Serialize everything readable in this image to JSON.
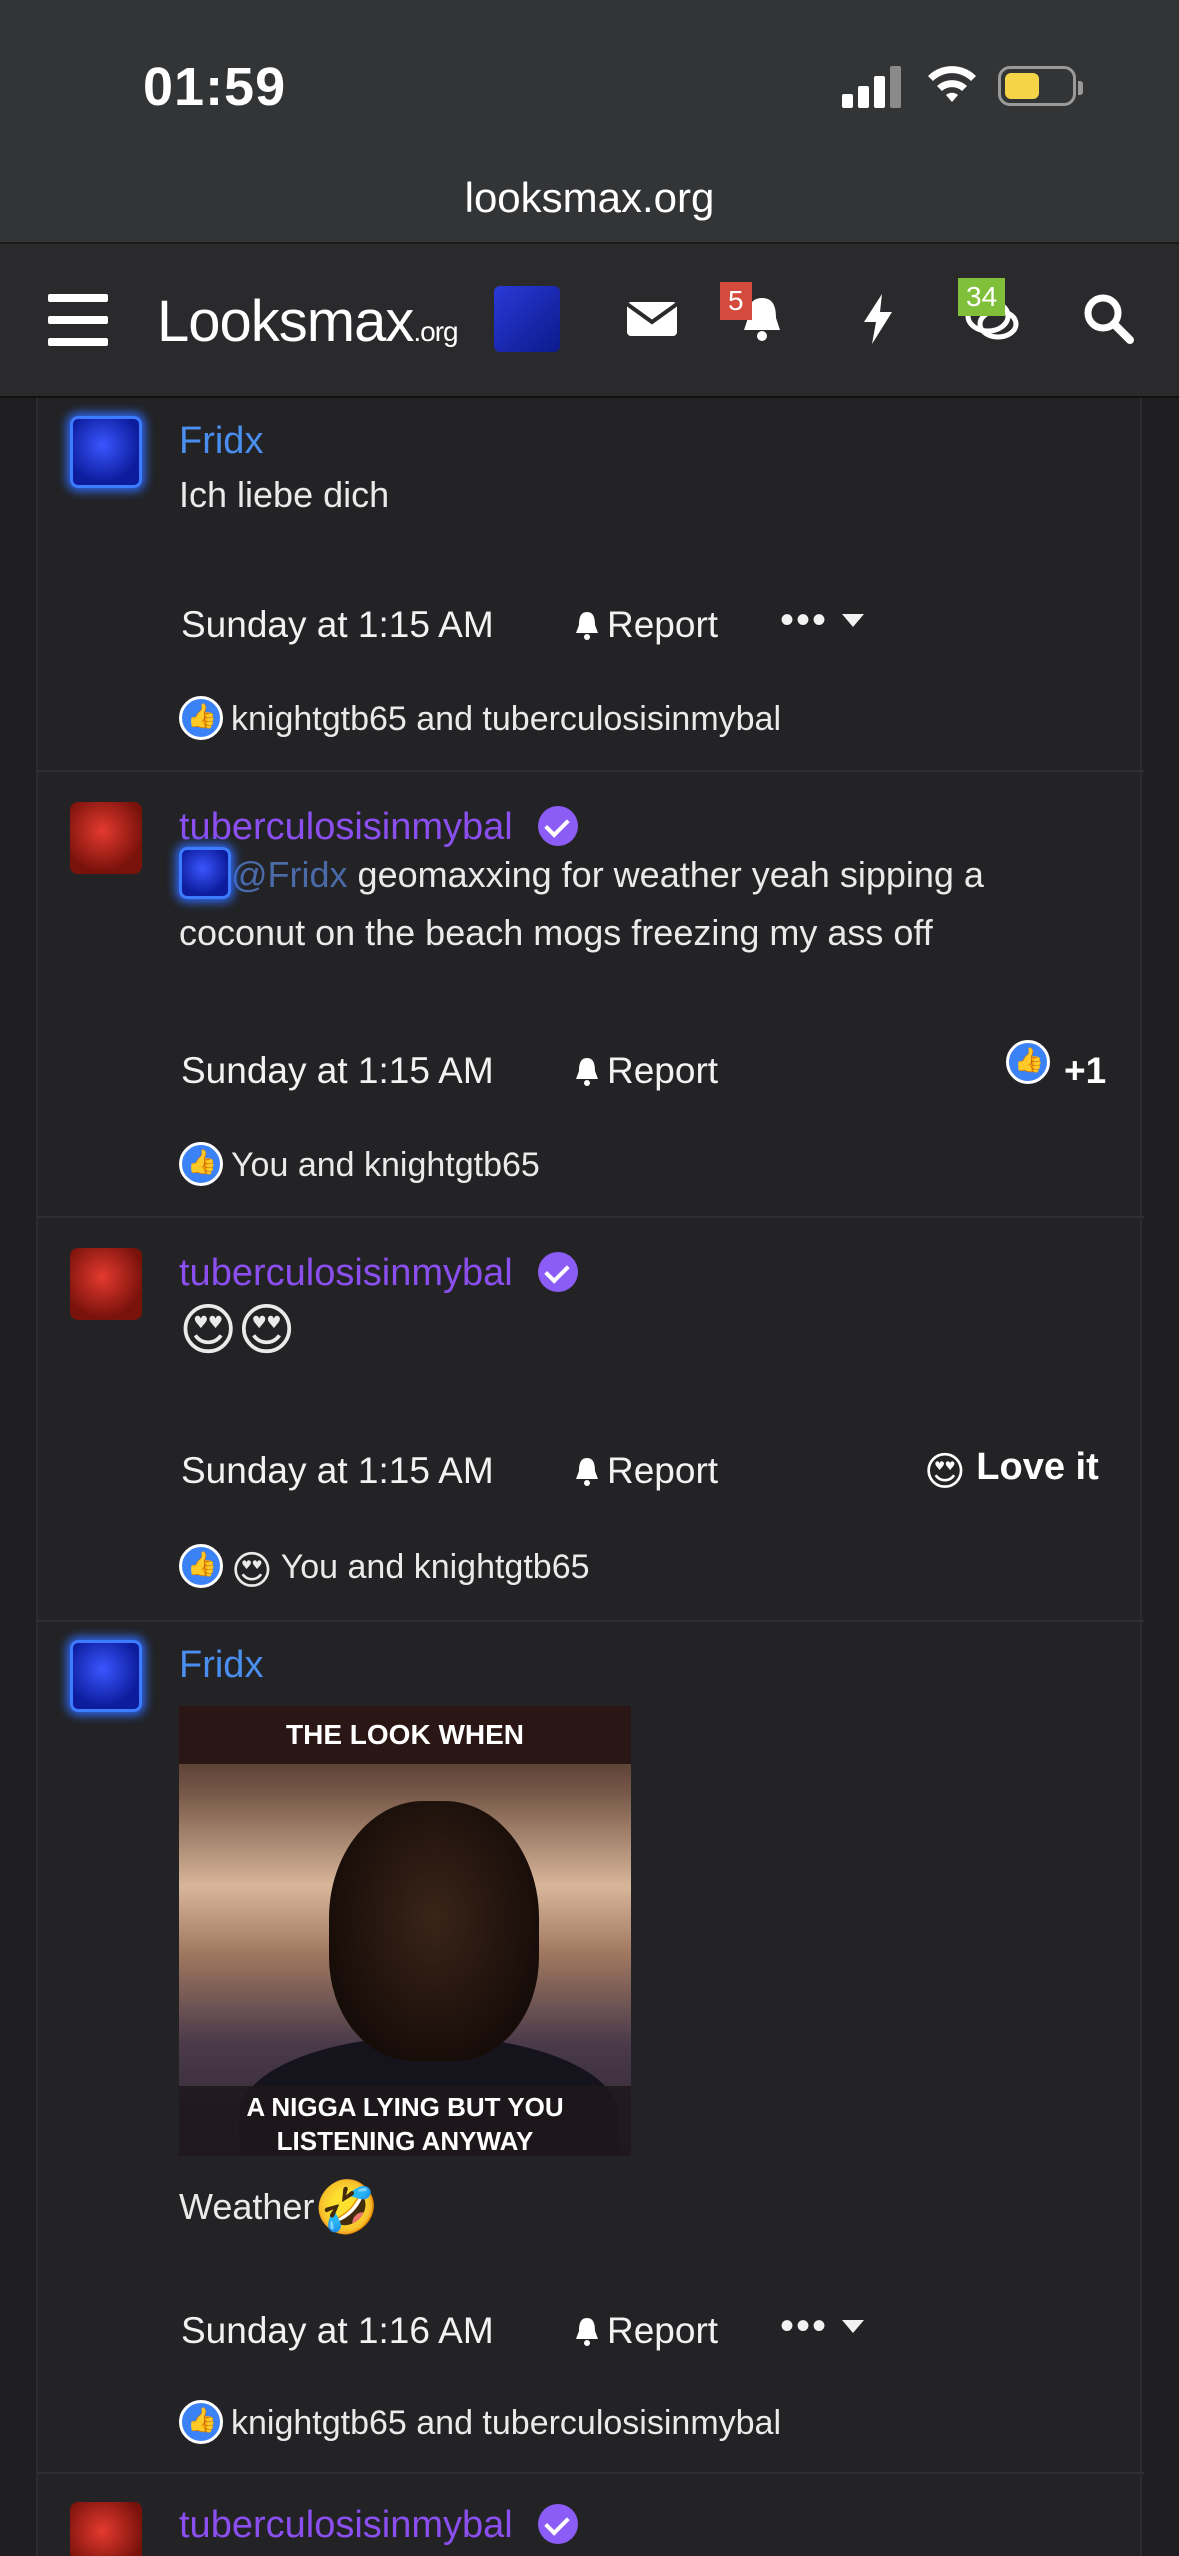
{
  "status_bar": {
    "time": "01:59"
  },
  "browser": {
    "url": "looksmax.org"
  },
  "nav": {
    "logo_main": "Looksmax",
    "logo_suffix": ".org",
    "alerts_badge": "5",
    "conversations_badge": "34"
  },
  "posts": [
    {
      "author": "Fridx",
      "text": "Ich liebe dich",
      "time": "Sunday at 1:15 AM",
      "report": "Report",
      "reactions_text": "knightgtb65 and tuberculosisinmybal"
    },
    {
      "author": "tuberculosisinmybal",
      "mention": "@Fridx",
      "text_line1": " geomaxxing for weather yeah sipping a",
      "text_line2": "coconut on the beach mogs freezing my ass off",
      "time": "Sunday at 1:15 AM",
      "report": "Report",
      "reaction_count": "+1",
      "reactions_text": "You and knightgtb65"
    },
    {
      "author": "tuberculosisinmybal",
      "text": "😍😍",
      "time": "Sunday at 1:15 AM",
      "report": "Report",
      "reaction_label": "Love it",
      "reactions_text": "You and knightgtb65"
    },
    {
      "author": "Fridx",
      "image_top": "THE LOOK WHEN",
      "image_bottom_1": "A NIGGA LYING BUT YOU",
      "image_bottom_2": "LISTENING ANYWAY",
      "text": "Weather",
      "time": "Sunday at 1:16 AM",
      "report": "Report",
      "reactions_text": "knightgtb65 and tuberculosisinmybal"
    },
    {
      "author": "tuberculosisinmybal"
    }
  ]
}
